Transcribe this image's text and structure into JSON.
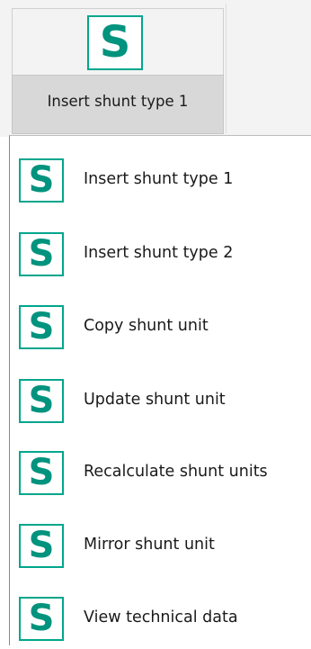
{
  "accent_color": "#00a68c",
  "ribbon": {
    "split_button": {
      "icon": "shunt-s-icon",
      "icon_glyph": "S",
      "label": "Insert shunt type 1"
    }
  },
  "menu": {
    "items": [
      {
        "icon": "shunt-s-icon",
        "icon_glyph": "S",
        "label": "Insert shunt type 1"
      },
      {
        "icon": "shunt-s-icon",
        "icon_glyph": "S",
        "label": "Insert shunt type 2"
      },
      {
        "icon": "shunt-s-icon",
        "icon_glyph": "S",
        "label": "Copy shunt unit"
      },
      {
        "icon": "shunt-s-icon",
        "icon_glyph": "S",
        "label": "Update shunt unit"
      },
      {
        "icon": "shunt-s-icon",
        "icon_glyph": "S",
        "label": "Recalculate shunt units"
      },
      {
        "icon": "shunt-s-icon",
        "icon_glyph": "S",
        "label": "Mirror shunt unit"
      },
      {
        "icon": "shunt-s-icon",
        "icon_glyph": "S",
        "label": "View technical data"
      }
    ]
  }
}
